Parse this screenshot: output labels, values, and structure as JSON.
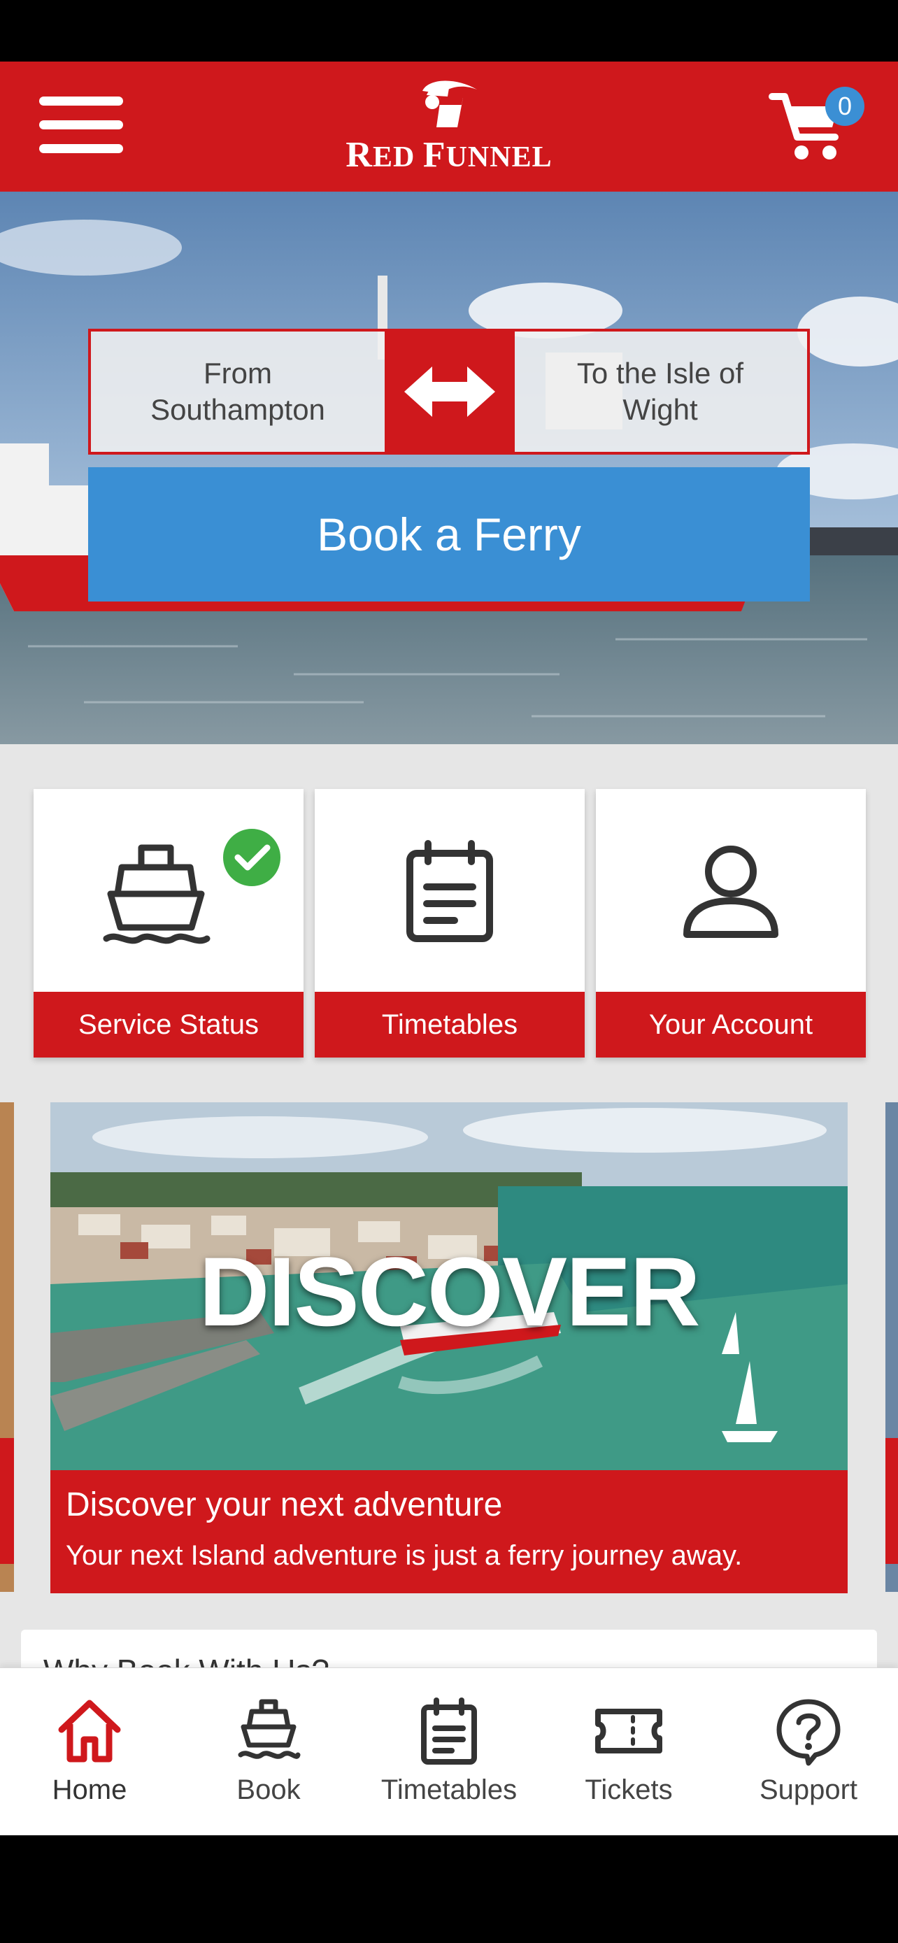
{
  "header": {
    "logo_text_big1": "R",
    "logo_text_small1": "ED ",
    "logo_text_big2": "F",
    "logo_text_small2": "UNNEL",
    "cart_count": "0"
  },
  "booking": {
    "from_label": "From\nSouthampton",
    "to_label": "To the Isle of\nWight",
    "book_button": "Book a Ferry"
  },
  "tiles": [
    {
      "label": "Service Status",
      "icon": "ferry-status-icon"
    },
    {
      "label": "Timetables",
      "icon": "timetable-icon"
    },
    {
      "label": "Your Account",
      "icon": "account-icon"
    }
  ],
  "promo": {
    "image_word": "DISCOVER",
    "title": "Discover your next adventure",
    "subtitle": "Your next Island adventure is just a ferry journey away."
  },
  "why_section": {
    "title": "Why Book With Us?"
  },
  "bottom_nav": [
    {
      "label": "Home",
      "icon": "home-icon",
      "active": true
    },
    {
      "label": "Book",
      "icon": "ferry-icon",
      "active": false
    },
    {
      "label": "Timetables",
      "icon": "timetable-icon",
      "active": false
    },
    {
      "label": "Tickets",
      "icon": "ticket-icon",
      "active": false
    },
    {
      "label": "Support",
      "icon": "help-icon",
      "active": false
    }
  ],
  "colors": {
    "brand_red": "#cf181c",
    "action_blue": "#3a8fd4",
    "status_green": "#3fae45"
  }
}
